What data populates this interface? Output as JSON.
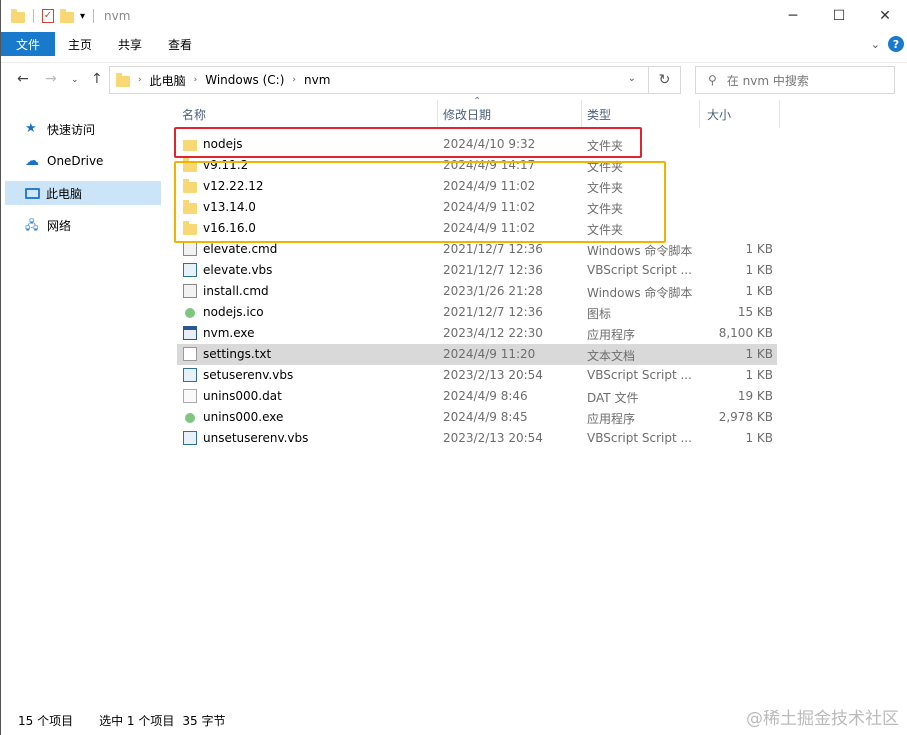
{
  "window": {
    "title": "nvm",
    "minimize": "─",
    "maximize": "☐",
    "close": "✕"
  },
  "ribbon": {
    "tabs": [
      "文件",
      "主页",
      "共享",
      "查看"
    ],
    "help": "?"
  },
  "address": {
    "crumbs": [
      "此电脑",
      "Windows (C:)",
      "nvm"
    ],
    "search_placeholder": "在 nvm 中搜索"
  },
  "nav": {
    "items": [
      {
        "label": "快速访问",
        "icon": "star-icon"
      },
      {
        "label": "OneDrive",
        "icon": "cloud-icon"
      },
      {
        "label": "此电脑",
        "icon": "computer-icon",
        "selected": true
      },
      {
        "label": "网络",
        "icon": "network-icon"
      }
    ]
  },
  "columns": {
    "name": "名称",
    "date": "修改日期",
    "type": "类型",
    "size": "大小"
  },
  "files": [
    {
      "name": "nodejs",
      "date": "2024/4/10 9:32",
      "type": "文件夹",
      "size": "",
      "icon": "folderlink"
    },
    {
      "name": "v9.11.2",
      "date": "2024/4/9 14:17",
      "type": "文件夹",
      "size": "",
      "icon": "folder"
    },
    {
      "name": "v12.22.12",
      "date": "2024/4/9 11:02",
      "type": "文件夹",
      "size": "",
      "icon": "folder"
    },
    {
      "name": "v13.14.0",
      "date": "2024/4/9 11:02",
      "type": "文件夹",
      "size": "",
      "icon": "folder"
    },
    {
      "name": "v16.16.0",
      "date": "2024/4/9 11:02",
      "type": "文件夹",
      "size": "",
      "icon": "folder"
    },
    {
      "name": "elevate.cmd",
      "date": "2021/12/7 12:36",
      "type": "Windows 命令脚本",
      "size": "1 KB",
      "icon": "cmd"
    },
    {
      "name": "elevate.vbs",
      "date": "2021/12/7 12:36",
      "type": "VBScript Script ...",
      "size": "1 KB",
      "icon": "vbs"
    },
    {
      "name": "install.cmd",
      "date": "2023/1/26 21:28",
      "type": "Windows 命令脚本",
      "size": "1 KB",
      "icon": "cmd"
    },
    {
      "name": "nodejs.ico",
      "date": "2021/12/7 12:36",
      "type": "图标",
      "size": "15 KB",
      "icon": "ico"
    },
    {
      "name": "nvm.exe",
      "date": "2023/4/12 22:30",
      "type": "应用程序",
      "size": "8,100 KB",
      "icon": "exe"
    },
    {
      "name": "settings.txt",
      "date": "2024/4/9 11:20",
      "type": "文本文档",
      "size": "1 KB",
      "icon": "txt",
      "selected": true
    },
    {
      "name": "setuserenv.vbs",
      "date": "2023/2/13 20:54",
      "type": "VBScript Script ...",
      "size": "1 KB",
      "icon": "vbs"
    },
    {
      "name": "unins000.dat",
      "date": "2024/4/9 8:46",
      "type": "DAT 文件",
      "size": "19 KB",
      "icon": "dat"
    },
    {
      "name": "unins000.exe",
      "date": "2024/4/9 8:45",
      "type": "应用程序",
      "size": "2,978 KB",
      "icon": "ico"
    },
    {
      "name": "unsetuserenv.vbs",
      "date": "2023/2/13 20:54",
      "type": "VBScript Script ...",
      "size": "1 KB",
      "icon": "vbs"
    }
  ],
  "status": {
    "count": "15 个项目",
    "selected": "选中 1 个项目",
    "bytes": "35 字节"
  },
  "watermark": "@稀土掘金技术社区"
}
